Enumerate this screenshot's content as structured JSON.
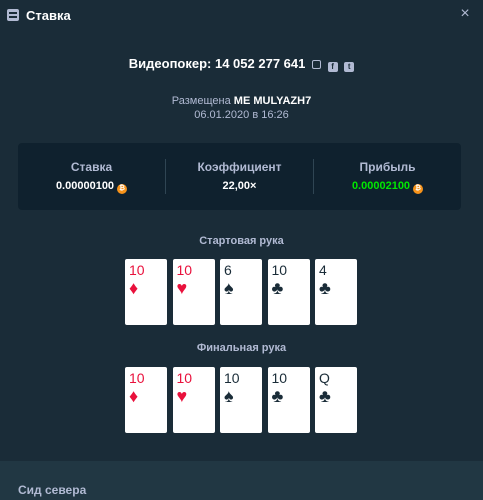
{
  "header": {
    "title": "Ставка",
    "close": "×"
  },
  "game": {
    "label": "Видеопокер: 14 052 277 641"
  },
  "placed": {
    "prefix": "Размещена",
    "user": "ME MULYAZH7",
    "date": "06.01.2020 в 16:26"
  },
  "stats": [
    {
      "label": "Ставка",
      "value": "0.00000100",
      "color": "#ffffff"
    },
    {
      "label": "Коэффициент",
      "value": "22,00×",
      "color": "#ffffff"
    },
    {
      "label": "Прибыль",
      "value": "0.00002100",
      "color": "#00e701"
    }
  ],
  "start_hand": {
    "title": "Стартовая рука",
    "cards": [
      {
        "rank": "10",
        "suit": "♦",
        "color": "red"
      },
      {
        "rank": "10",
        "suit": "♥",
        "color": "red"
      },
      {
        "rank": "6",
        "suit": "♠",
        "color": "black"
      },
      {
        "rank": "10",
        "suit": "♣",
        "color": "black"
      },
      {
        "rank": "4",
        "suit": "♣",
        "color": "black"
      }
    ]
  },
  "final_hand": {
    "title": "Финальная рука",
    "cards": [
      {
        "rank": "10",
        "suit": "♦",
        "color": "red"
      },
      {
        "rank": "10",
        "suit": "♥",
        "color": "red"
      },
      {
        "rank": "10",
        "suit": "♠",
        "color": "black"
      },
      {
        "rank": "10",
        "suit": "♣",
        "color": "black"
      },
      {
        "rank": "Q",
        "suit": "♣",
        "color": "black"
      }
    ]
  },
  "seed": {
    "title": "Сид севера"
  }
}
